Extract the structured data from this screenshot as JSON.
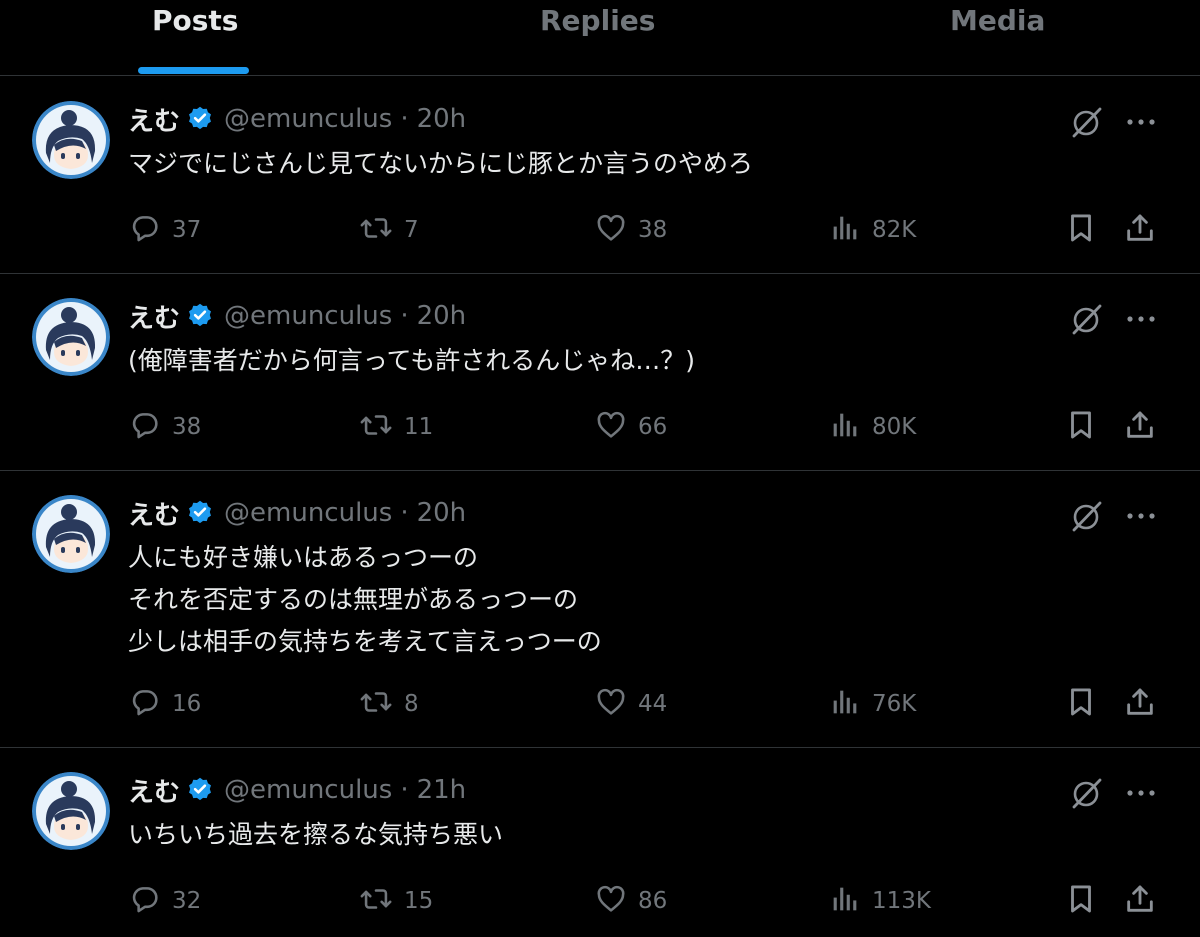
{
  "tabs": [
    {
      "label": "Posts",
      "active": true
    },
    {
      "label": "Replies",
      "active": false
    },
    {
      "label": "Media",
      "active": false
    }
  ],
  "colors": {
    "accent": "#1d9bf0",
    "background": "#000000",
    "text": "#e7e9ea",
    "muted": "#71767b",
    "divider": "#2f3336"
  },
  "icons": {
    "verified": "verified-badge-icon",
    "grok": "grok-icon",
    "more": "more-icon",
    "reply": "reply-icon",
    "repost": "repost-icon",
    "like": "like-icon",
    "views": "views-icon",
    "bookmark": "bookmark-icon",
    "share": "share-icon"
  },
  "posts": [
    {
      "display_name": "えむ",
      "handle": "@emunculus",
      "separator": "·",
      "time": "20h",
      "text": "マジでにじさんじ見てないからにじ豚とか言うのやめろ",
      "replies": "37",
      "reposts": "7",
      "likes": "38",
      "views": "82K"
    },
    {
      "display_name": "えむ",
      "handle": "@emunculus",
      "separator": "·",
      "time": "20h",
      "text": "(俺障害者だから何言っても許されるんじゃね…？)",
      "replies": "38",
      "reposts": "11",
      "likes": "66",
      "views": "80K"
    },
    {
      "display_name": "えむ",
      "handle": "@emunculus",
      "separator": "·",
      "time": "20h",
      "text": "人にも好き嫌いはあるっつーの\nそれを否定するのは無理があるっつーの\n少しは相手の気持ちを考えて言えっつーの",
      "replies": "16",
      "reposts": "8",
      "likes": "44",
      "views": "76K"
    },
    {
      "display_name": "えむ",
      "handle": "@emunculus",
      "separator": "·",
      "time": "21h",
      "text": "いちいち過去を擦るな気持ち悪い",
      "replies": "32",
      "reposts": "15",
      "likes": "86",
      "views": "113K"
    }
  ]
}
